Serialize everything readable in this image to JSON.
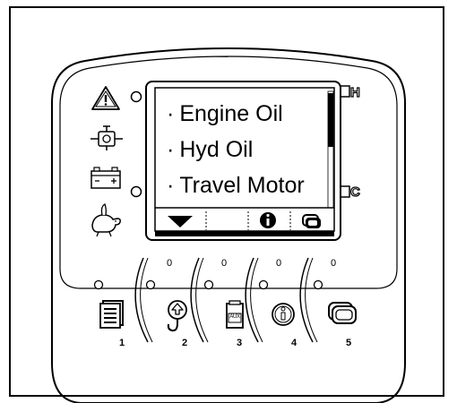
{
  "screen": {
    "menu_items": [
      "Engine Oil",
      "Hyd Oil",
      "Travel Motor"
    ],
    "bullet": "·",
    "softkeys": [
      "down-arrow",
      "blank",
      "blank",
      "info",
      "screen-toggle"
    ]
  },
  "gauges": {
    "top_letter": "H",
    "bottom_letter": "C"
  },
  "left_indicators": [
    "warning-triangle-icon",
    "engine-oil-pressure-icon",
    "battery-icon",
    "rabbit-turtle-speed-icon"
  ],
  "buttons": [
    {
      "number": "1",
      "icon": "menu-list-icon"
    },
    {
      "number": "2",
      "icon": "hook-up-icon"
    },
    {
      "number": "3",
      "icon": "aux-icon",
      "icon_text": "AUX"
    },
    {
      "number": "4",
      "icon": "info-icon"
    },
    {
      "number": "5",
      "icon": "screen-toggle-icon"
    }
  ],
  "led_labels": [
    "0",
    "0",
    "0",
    "0"
  ],
  "colors": {
    "ink": "#000000",
    "paper": "#ffffff"
  }
}
